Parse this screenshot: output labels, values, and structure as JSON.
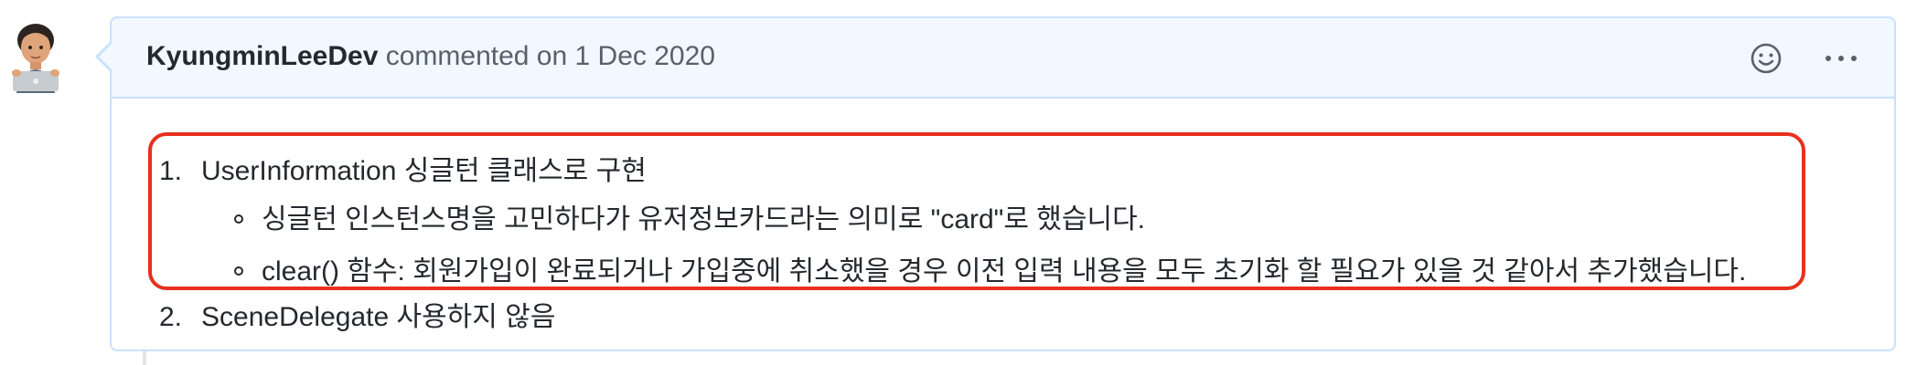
{
  "comment": {
    "author": "KyungminLeeDev",
    "action": "commented on",
    "date": "1 Dec 2020",
    "icons": {
      "avatar": "memoji-avatar-with-laptop",
      "reaction": "smiley-icon",
      "menu": "kebab-icon"
    },
    "body": {
      "items": [
        {
          "number": "1.",
          "text": "UserInformation 싱글턴 클래스로 구현",
          "subitems": [
            "싱글턴 인스턴스명을 고민하다가 유저정보카드라는 의미로 \"card\"로 했습니다.",
            "clear() 함수: 회원가입이 완료되거나 가입중에 취소했을 경우 이전 입력 내용을 모두 초기화 할 필요가 있을 것 같아서 추가했습니다."
          ]
        },
        {
          "number": "2.",
          "text": "SceneDelegate 사용하지 않음",
          "subitems": []
        }
      ]
    },
    "highlight_color": "#e8301f",
    "header_background": "#f1f8ff",
    "border_color": "#c8e1ff"
  }
}
